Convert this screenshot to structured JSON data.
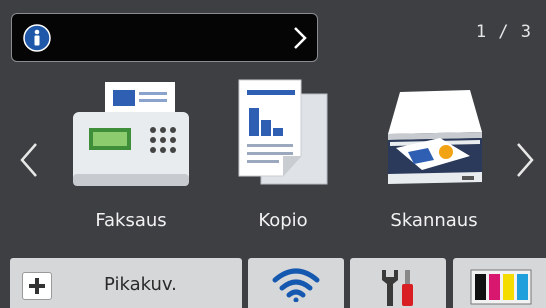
{
  "status_bar": {
    "info_icon": "info-icon",
    "arrow_icon": "chevron-right-icon",
    "page_indicator": "1 / 3"
  },
  "apps": [
    {
      "label": "Faksaus",
      "icon": "fax-icon"
    },
    {
      "label": "Kopio",
      "icon": "copy-icon"
    },
    {
      "label": "Skannaus",
      "icon": "scan-icon"
    }
  ],
  "nav": {
    "prev_icon": "chevron-left-icon",
    "next_icon": "chevron-right-icon"
  },
  "bottom_bar": {
    "shortcut_label": "Pikakuv.",
    "shortcut_icon": "plus-icon",
    "wifi_icon": "wifi-icon",
    "settings_icon": "settings-tools-icon",
    "ink_icon": "ink-cartridges-icon"
  },
  "colors": {
    "background": "#3d3f43",
    "info_blue": "#1f58a8",
    "wifi_blue": "#1458b0",
    "ink_cyan": "#1fa0dc",
    "ink_magenta": "#d8176f",
    "ink_yellow": "#f5dc00",
    "ink_black": "#111111",
    "tools_red": "#d81d23"
  }
}
